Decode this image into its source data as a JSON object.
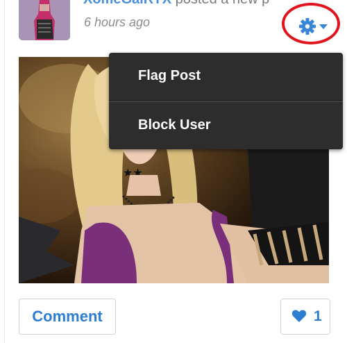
{
  "post": {
    "author": "XomeGalRYX",
    "action_text": " posted a new p",
    "timestamp": "6 hours ago"
  },
  "menu": {
    "button_icon": "gear-icon",
    "items": [
      {
        "label": "Flag Post"
      },
      {
        "label": "Block User"
      }
    ]
  },
  "footer": {
    "comment_label": "Comment",
    "like_icon": "heart-icon",
    "like_count": "1"
  },
  "colors": {
    "link_blue": "#2d7dd2",
    "menu_bg": "#2d2d2d",
    "highlight_red": "#e0141c"
  }
}
